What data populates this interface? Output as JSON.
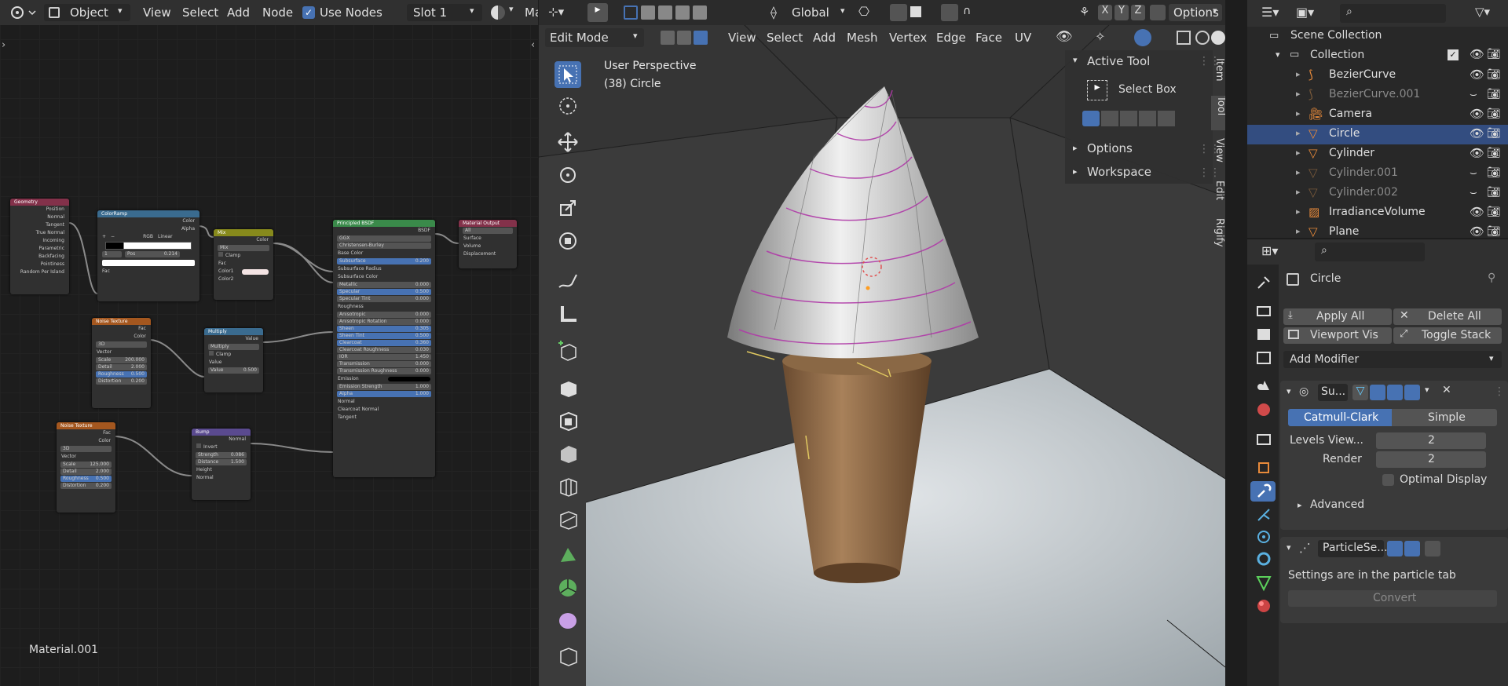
{
  "node_editor": {
    "header": {
      "object_mode": "Object",
      "menus": [
        "View",
        "Select",
        "Add",
        "Node"
      ],
      "use_nodes_label": "Use Nodes",
      "slot": "Slot 1",
      "truncated_label": "Ma"
    },
    "material_name": "Material.001",
    "nodes": {
      "geometry": {
        "title": "Geometry",
        "outputs": [
          "Position",
          "Normal",
          "Tangent",
          "True Normal",
          "Incoming",
          "Parametric",
          "Backfacing",
          "Pointiness",
          "Random Per Island"
        ]
      },
      "colorramp": {
        "title": "ColorRamp",
        "outputs": [
          "Color",
          "Alpha"
        ],
        "mode": "RGB",
        "interp": "Linear",
        "index": "1",
        "pos_label": "Pos",
        "pos": "0.214",
        "input": "Fac"
      },
      "mix": {
        "title": "Mix",
        "output": "Color",
        "mode": "Mix",
        "clamp": "Clamp",
        "inputs": [
          "Fac",
          "Color1",
          "Color2"
        ]
      },
      "principled": {
        "title": "Principled BSDF",
        "output": "BSDF",
        "dist": "GGX",
        "sss": "Christensen-Burley",
        "rows": [
          [
            "Base Color",
            ""
          ],
          [
            "Subsurface",
            "0.200"
          ],
          [
            "Subsurface Radius",
            ""
          ],
          [
            "Subsurface Color",
            ""
          ],
          [
            "Metallic",
            "0.000"
          ],
          [
            "Specular",
            "0.500"
          ],
          [
            "Specular Tint",
            "0.000"
          ],
          [
            "Roughness",
            ""
          ],
          [
            "Anisotropic",
            "0.000"
          ],
          [
            "Anisotropic Rotation",
            "0.000"
          ],
          [
            "Sheen",
            "0.305"
          ],
          [
            "Sheen Tint",
            "0.500"
          ],
          [
            "Clearcoat",
            "0.360"
          ],
          [
            "Clearcoat Roughness",
            "0.030"
          ],
          [
            "IOR",
            "1.450"
          ],
          [
            "Transmission",
            "0.000"
          ],
          [
            "Transmission Roughness",
            "0.000"
          ],
          [
            "Emission",
            ""
          ],
          [
            "Emission Strength",
            "1.000"
          ],
          [
            "Alpha",
            "1.000"
          ],
          [
            "Normal",
            ""
          ],
          [
            "Clearcoat Normal",
            ""
          ],
          [
            "Tangent",
            ""
          ]
        ]
      },
      "output": {
        "title": "Material Output",
        "target": "All",
        "inputs": [
          "Surface",
          "Volume",
          "Displacement"
        ]
      },
      "noise1": {
        "title": "Noise Texture",
        "outputs": [
          "Fac",
          "Color"
        ],
        "dim": "3D",
        "rows": [
          [
            "Vector",
            ""
          ],
          [
            "Scale",
            "200.000"
          ],
          [
            "Detail",
            "2.000"
          ],
          [
            "Roughness",
            "0.500"
          ],
          [
            "Distortion",
            "0.200"
          ]
        ]
      },
      "multiply": {
        "title": "Multiply",
        "output": "Value",
        "mode": "Multiply",
        "clamp": "Clamp",
        "inputs": [
          [
            "Value",
            ""
          ],
          [
            "Value",
            "0.500"
          ]
        ]
      },
      "noise2": {
        "title": "Noise Texture",
        "outputs": [
          "Fac",
          "Color"
        ],
        "dim": "3D",
        "rows": [
          [
            "Vector",
            ""
          ],
          [
            "Scale",
            "125.000"
          ],
          [
            "Detail",
            "2.000"
          ],
          [
            "Roughness",
            "0.500"
          ],
          [
            "Distortion",
            "0.200"
          ]
        ]
      },
      "bump": {
        "title": "Bump",
        "output": "Normal",
        "invert": "Invert",
        "rows": [
          [
            "Strength",
            "0.086"
          ],
          [
            "Distance",
            "1.500"
          ],
          [
            "Height",
            ""
          ],
          [
            "Normal",
            ""
          ]
        ]
      }
    }
  },
  "viewport": {
    "header1": {
      "transform": "Global",
      "options": "Options",
      "axes": [
        "X",
        "Y",
        "Z"
      ]
    },
    "header2": {
      "mode": "Edit Mode",
      "menus": [
        "View",
        "Select",
        "Add",
        "Mesh",
        "Vertex",
        "Edge",
        "Face",
        "UV"
      ]
    },
    "overlay_line1": "User Perspective",
    "overlay_line2": "(38) Circle",
    "tool_panel": {
      "header": "Active Tool",
      "tool": "Select Box",
      "options": "Options",
      "workspace": "Workspace"
    },
    "side_tabs": [
      "Item",
      "Tool",
      "View",
      "Edit",
      "Rigify"
    ]
  },
  "outliner": {
    "root": "Scene Collection",
    "collection": "Collection",
    "items": [
      {
        "name": "BezierCurve",
        "dim": false
      },
      {
        "name": "BezierCurve.001",
        "dim": true
      },
      {
        "name": "Camera",
        "dim": false
      },
      {
        "name": "Circle",
        "dim": false
      },
      {
        "name": "Cylinder",
        "dim": false
      },
      {
        "name": "Cylinder.001",
        "dim": true
      },
      {
        "name": "Cylinder.002",
        "dim": true
      },
      {
        "name": "IrradianceVolume",
        "dim": false
      },
      {
        "name": "Plane",
        "dim": false
      }
    ]
  },
  "properties": {
    "object_name": "Circle",
    "apply_all": "Apply All",
    "delete_all": "Delete All",
    "viewport_vis": "Viewport Vis",
    "toggle_stack": "Toggle Stack",
    "add_modifier": "Add Modifier",
    "subsurf": {
      "name": "Su...",
      "catmull": "Catmull-Clark",
      "simple": "Simple",
      "levels_label": "Levels View...",
      "levels": "2",
      "render_label": "Render",
      "render": "2",
      "optimal": "Optimal Display",
      "advanced": "Advanced"
    },
    "particle": {
      "name": "ParticleSe...",
      "note": "Settings are in the particle tab",
      "convert": "Convert"
    }
  },
  "colors": {
    "accent": "#4772b3",
    "selected_row": "#334d80",
    "header": "#303030"
  }
}
